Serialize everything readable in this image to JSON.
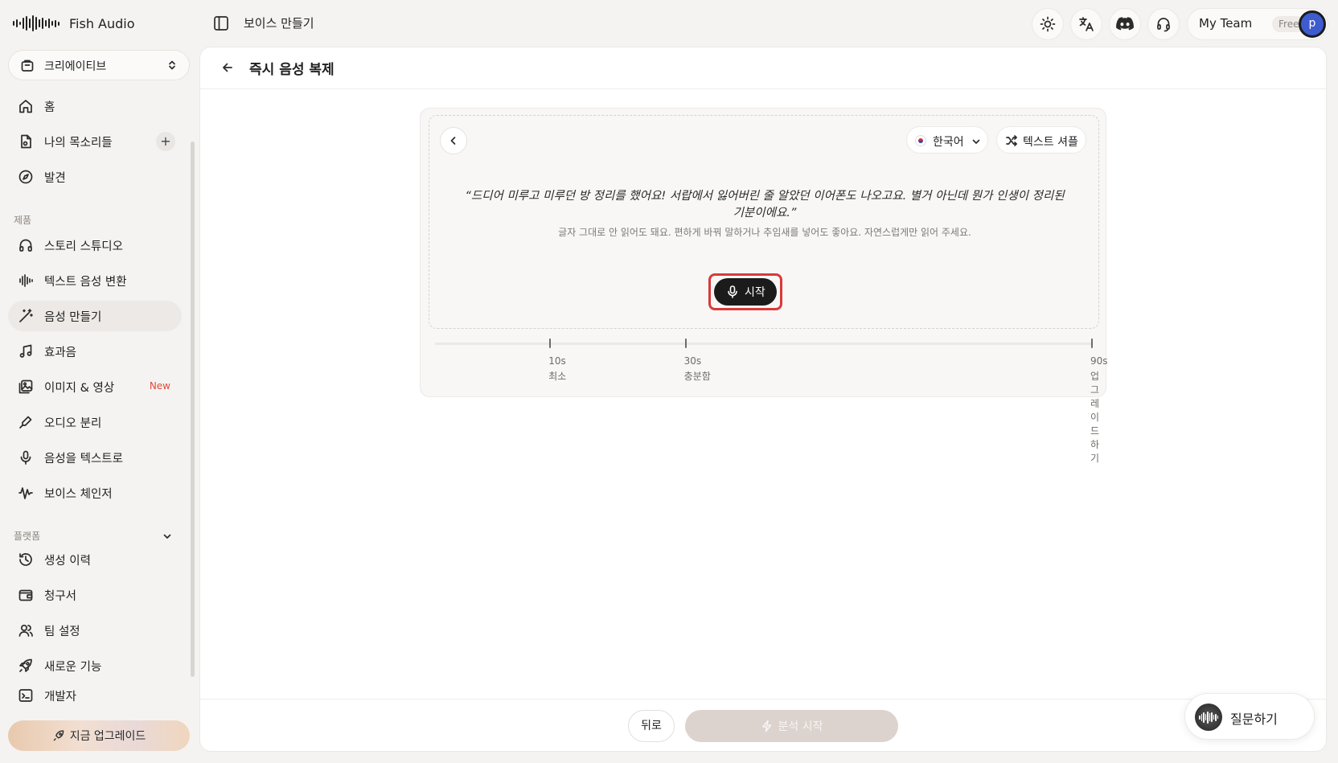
{
  "app": {
    "name": "Fish Audio"
  },
  "header": {
    "breadcrumb": "보이스 만들기",
    "team": {
      "name": "My Team",
      "plan": "Free",
      "avatar_initial": "p"
    },
    "icons": [
      "sun-icon",
      "translate-icon",
      "discord-icon",
      "headset-icon"
    ]
  },
  "sidebar": {
    "workspace": "크리에이티브",
    "items_top": [
      {
        "label": "홈",
        "icon": "home-icon"
      },
      {
        "label": "나의 목소리들",
        "icon": "file-icon",
        "action": "+"
      },
      {
        "label": "발견",
        "icon": "compass-icon"
      }
    ],
    "section_products": "제품",
    "items_products": [
      {
        "label": "스토리 스튜디오",
        "icon": "headphones-icon"
      },
      {
        "label": "텍스트 음성 변환",
        "icon": "waveform-icon"
      },
      {
        "label": "음성 만들기",
        "icon": "magic-wand-icon",
        "active": true
      },
      {
        "label": "효과음",
        "icon": "music-icon"
      },
      {
        "label": "이미지 & 영상",
        "icon": "image-icon",
        "badge": "New"
      },
      {
        "label": "오디오 분리",
        "icon": "split-icon"
      },
      {
        "label": "음성을 텍스트로",
        "icon": "mic-icon"
      },
      {
        "label": "보이스 체인저",
        "icon": "voice-wave-icon"
      }
    ],
    "section_platform": "플랫폼",
    "items_platform": [
      {
        "label": "생성 이력",
        "icon": "history-icon"
      },
      {
        "label": "청구서",
        "icon": "wallet-icon"
      },
      {
        "label": "팀 설정",
        "icon": "users-icon"
      },
      {
        "label": "새로운 기능",
        "icon": "rocket-icon"
      },
      {
        "label": "개발자",
        "icon": "terminal-icon"
      }
    ],
    "upgrade_label": "지금 업그레이드"
  },
  "main": {
    "title": "즉시 음성 복제",
    "language": "한국어",
    "shuffle_label": "텍스트 셔플",
    "prompt_text": "“드디어 미루고 미루던 방 정리를 했어요! 서랍에서 잃어버린 줄 알았던 이어폰도 나오고요. 별거 아닌데 뭔가 인생이 정리된 기분이에요.”",
    "prompt_hint": "글자 그대로 안 읽어도 돼요. 편하게 바꿔 말하거나 추임새를 넣어도 좋아요. 자연스럽게만 읽어 주세요.",
    "start_label": "시작",
    "recording_seconds": 0,
    "max_seconds": 90,
    "milestones": [
      {
        "seconds": 10,
        "time": "10s",
        "desc": "최소"
      },
      {
        "seconds": 30,
        "time": "30s",
        "desc": "충분함"
      },
      {
        "seconds": 90,
        "time": "90s",
        "desc": "업그레이드하기"
      }
    ],
    "back_label": "뒤로",
    "analyze_label": "분석 시작"
  },
  "ask_label": "질문하기"
}
